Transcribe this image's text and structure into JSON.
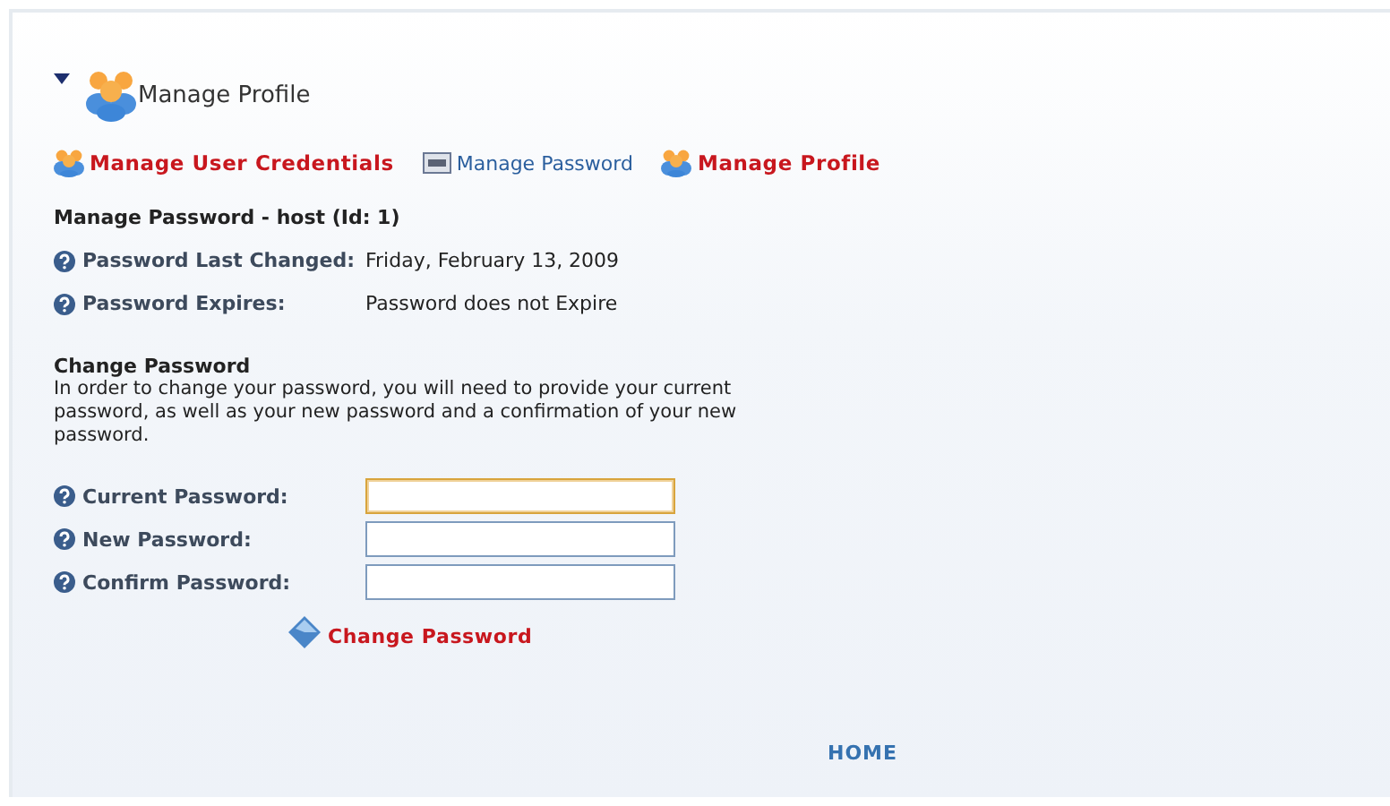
{
  "module": {
    "title": "Manage Profile",
    "expanded": true
  },
  "links": [
    {
      "label": "Manage User Credentials",
      "kind": "people",
      "active": true
    },
    {
      "label": "Manage Password",
      "kind": "card",
      "active": false
    },
    {
      "label": "Manage Profile",
      "kind": "people",
      "active": true
    }
  ],
  "heading": "Manage Password - host (Id: 1)",
  "info": [
    {
      "label": "Password Last Changed:",
      "value": "Friday, February 13, 2009"
    },
    {
      "label": "Password Expires:",
      "value": "Password does not Expire"
    }
  ],
  "change": {
    "title": "Change Password",
    "description": "In order to change your password, you will need to provide your current password, as well as your new password and a confirmation of your new password."
  },
  "fields": [
    {
      "label": "Current Password:",
      "focused": true
    },
    {
      "label": "New Password:",
      "focused": false
    },
    {
      "label": "Confirm Password:",
      "focused": false
    }
  ],
  "submit": "Change Password",
  "footer_link": "HOME"
}
